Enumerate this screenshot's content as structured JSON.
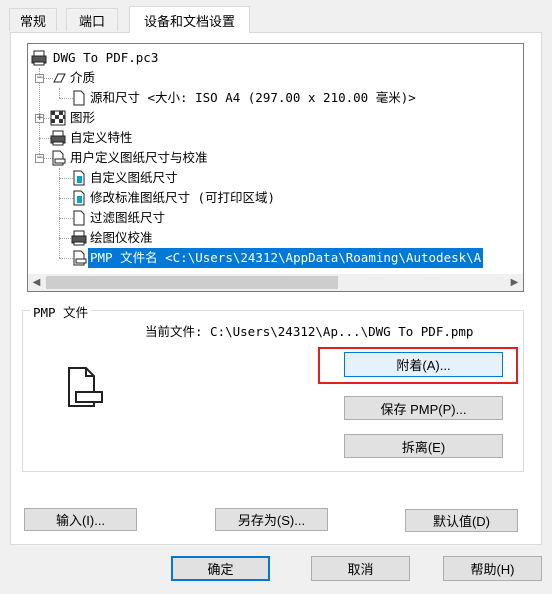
{
  "tabs": [
    {
      "label": "常规"
    },
    {
      "label": "端口"
    },
    {
      "label": "设备和文档设置"
    }
  ],
  "tree": {
    "items": [
      {
        "label": "DWG To PDF.pc3",
        "icon": "plotter-icon"
      },
      {
        "label": "介质",
        "icon": "media-icon"
      },
      {
        "label": "源和尺寸 <大小: ISO A4 (297.00 x 210.00 毫米)>",
        "icon": "page-icon"
      },
      {
        "label": "图形",
        "icon": "graphics-icon"
      },
      {
        "label": "自定义特性",
        "icon": "plotter-icon"
      },
      {
        "label": "用户定义图纸尺寸与校准",
        "icon": "page-icon"
      },
      {
        "label": "自定义图纸尺寸",
        "icon": "custom-paper-icon"
      },
      {
        "label": "修改标准图纸尺寸 (可打印区域)",
        "icon": "custom-paper-icon"
      },
      {
        "label": "过滤图纸尺寸",
        "icon": "page-icon"
      },
      {
        "label": "绘图仪校准",
        "icon": "plotter-icon"
      },
      {
        "label": "PMP 文件名 <C:\\Users\\24312\\AppData\\Roaming\\Autodesk\\A",
        "icon": "page-icon",
        "selected": true
      }
    ]
  },
  "pmp": {
    "group_label": "PMP 文件",
    "current_file": "当前文件: C:\\Users\\24312\\Ap...\\DWG To PDF.pmp",
    "attach_label": "附着(A)...",
    "save_label": "保存 PMP(P)...",
    "detach_label": "拆离(E)"
  },
  "panel_buttons": {
    "import_label": "输入(I)...",
    "saveas_label": "另存为(S)...",
    "default_label": "默认值(D)"
  },
  "dialog_buttons": {
    "ok_label": "确定",
    "cancel_label": "取消",
    "help_label": "帮助(H)"
  },
  "colors": {
    "selection": "#0078d7",
    "highlight_box": "#e02020"
  }
}
